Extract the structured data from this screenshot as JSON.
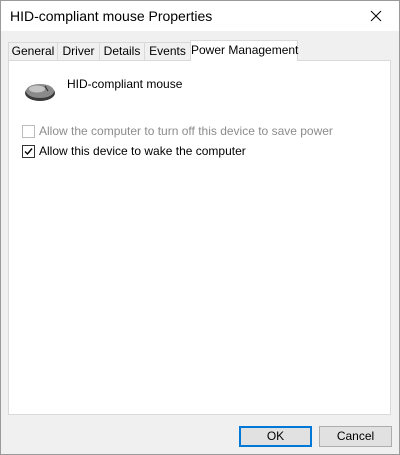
{
  "window": {
    "title": "HID-compliant mouse Properties"
  },
  "tabs": [
    {
      "label": "General",
      "active": false
    },
    {
      "label": "Driver",
      "active": false
    },
    {
      "label": "Details",
      "active": false
    },
    {
      "label": "Events",
      "active": false
    },
    {
      "label": "Power Management",
      "active": true
    }
  ],
  "device": {
    "name": "HID-compliant mouse",
    "icon": "mouse-icon"
  },
  "options": [
    {
      "label": "Allow the computer to turn off this device to save power",
      "checked": false,
      "enabled": false
    },
    {
      "label": "Allow this device to wake the computer",
      "checked": true,
      "enabled": true
    }
  ],
  "buttons": {
    "ok": "OK",
    "cancel": "Cancel"
  },
  "colors": {
    "accent": "#0078d7",
    "window_bg": "#f0f0f0",
    "panel_bg": "#ffffff",
    "disabled_text": "#8c8c8c"
  }
}
